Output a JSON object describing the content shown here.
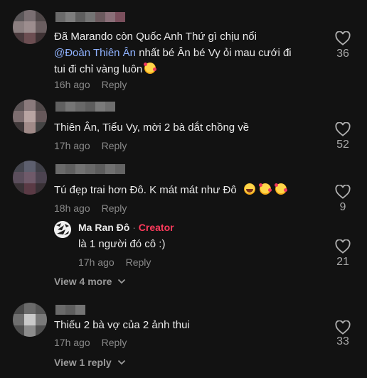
{
  "comments": [
    {
      "lines": [
        {
          "parts": [
            "Đã Marando còn Quốc Anh Thứ gì chịu nổi"
          ]
        },
        {
          "mention": "@Đoàn Thiên Ân",
          "parts": [
            " nhất bé Ân bé Vy ỏi mau cưới đi"
          ]
        },
        {
          "parts": [
            "tui đi chỉ vàng luôn"
          ],
          "emoji": [
            "smiling-face-with-hearts"
          ]
        }
      ],
      "time": "16h ago",
      "reply_label": "Reply",
      "likes": "36"
    },
    {
      "lines": [
        {
          "parts": [
            "Thiên Ân, Tiểu Vy, mời 2 bà dắt chồng về"
          ]
        }
      ],
      "time": "17h ago",
      "reply_label": "Reply",
      "likes": "52"
    },
    {
      "lines": [
        {
          "parts": [
            "Tú đẹp trai hơn Đô. K mát mát như Đô"
          ],
          "emoji": [
            "grinning-squinting-face",
            "smiling-face-with-hearts",
            "smiling-face-with-hearts"
          ]
        }
      ],
      "time": "18h ago",
      "reply_label": "Reply",
      "likes": "9"
    },
    {
      "lines": [
        {
          "parts": [
            "Thiếu 2 bà vợ của 2 ảnh thui"
          ]
        }
      ],
      "time": "17h ago",
      "reply_label": "Reply",
      "likes": "33"
    }
  ],
  "creator_reply": {
    "author": "Ma Ran Đô",
    "separator": " · ",
    "badge": "Creator",
    "text": "là 1 người đó cô :)",
    "time": "17h ago",
    "reply_label": "Reply",
    "likes": "21"
  },
  "view_more_1": "View 4 more",
  "view_more_2": "View 1 reply",
  "colors": {
    "background": "#121212",
    "creator_badge": "#ff3b5c",
    "mention": "#8fb2ff"
  },
  "icons": [
    "heart-icon",
    "chevron-down-icon"
  ]
}
